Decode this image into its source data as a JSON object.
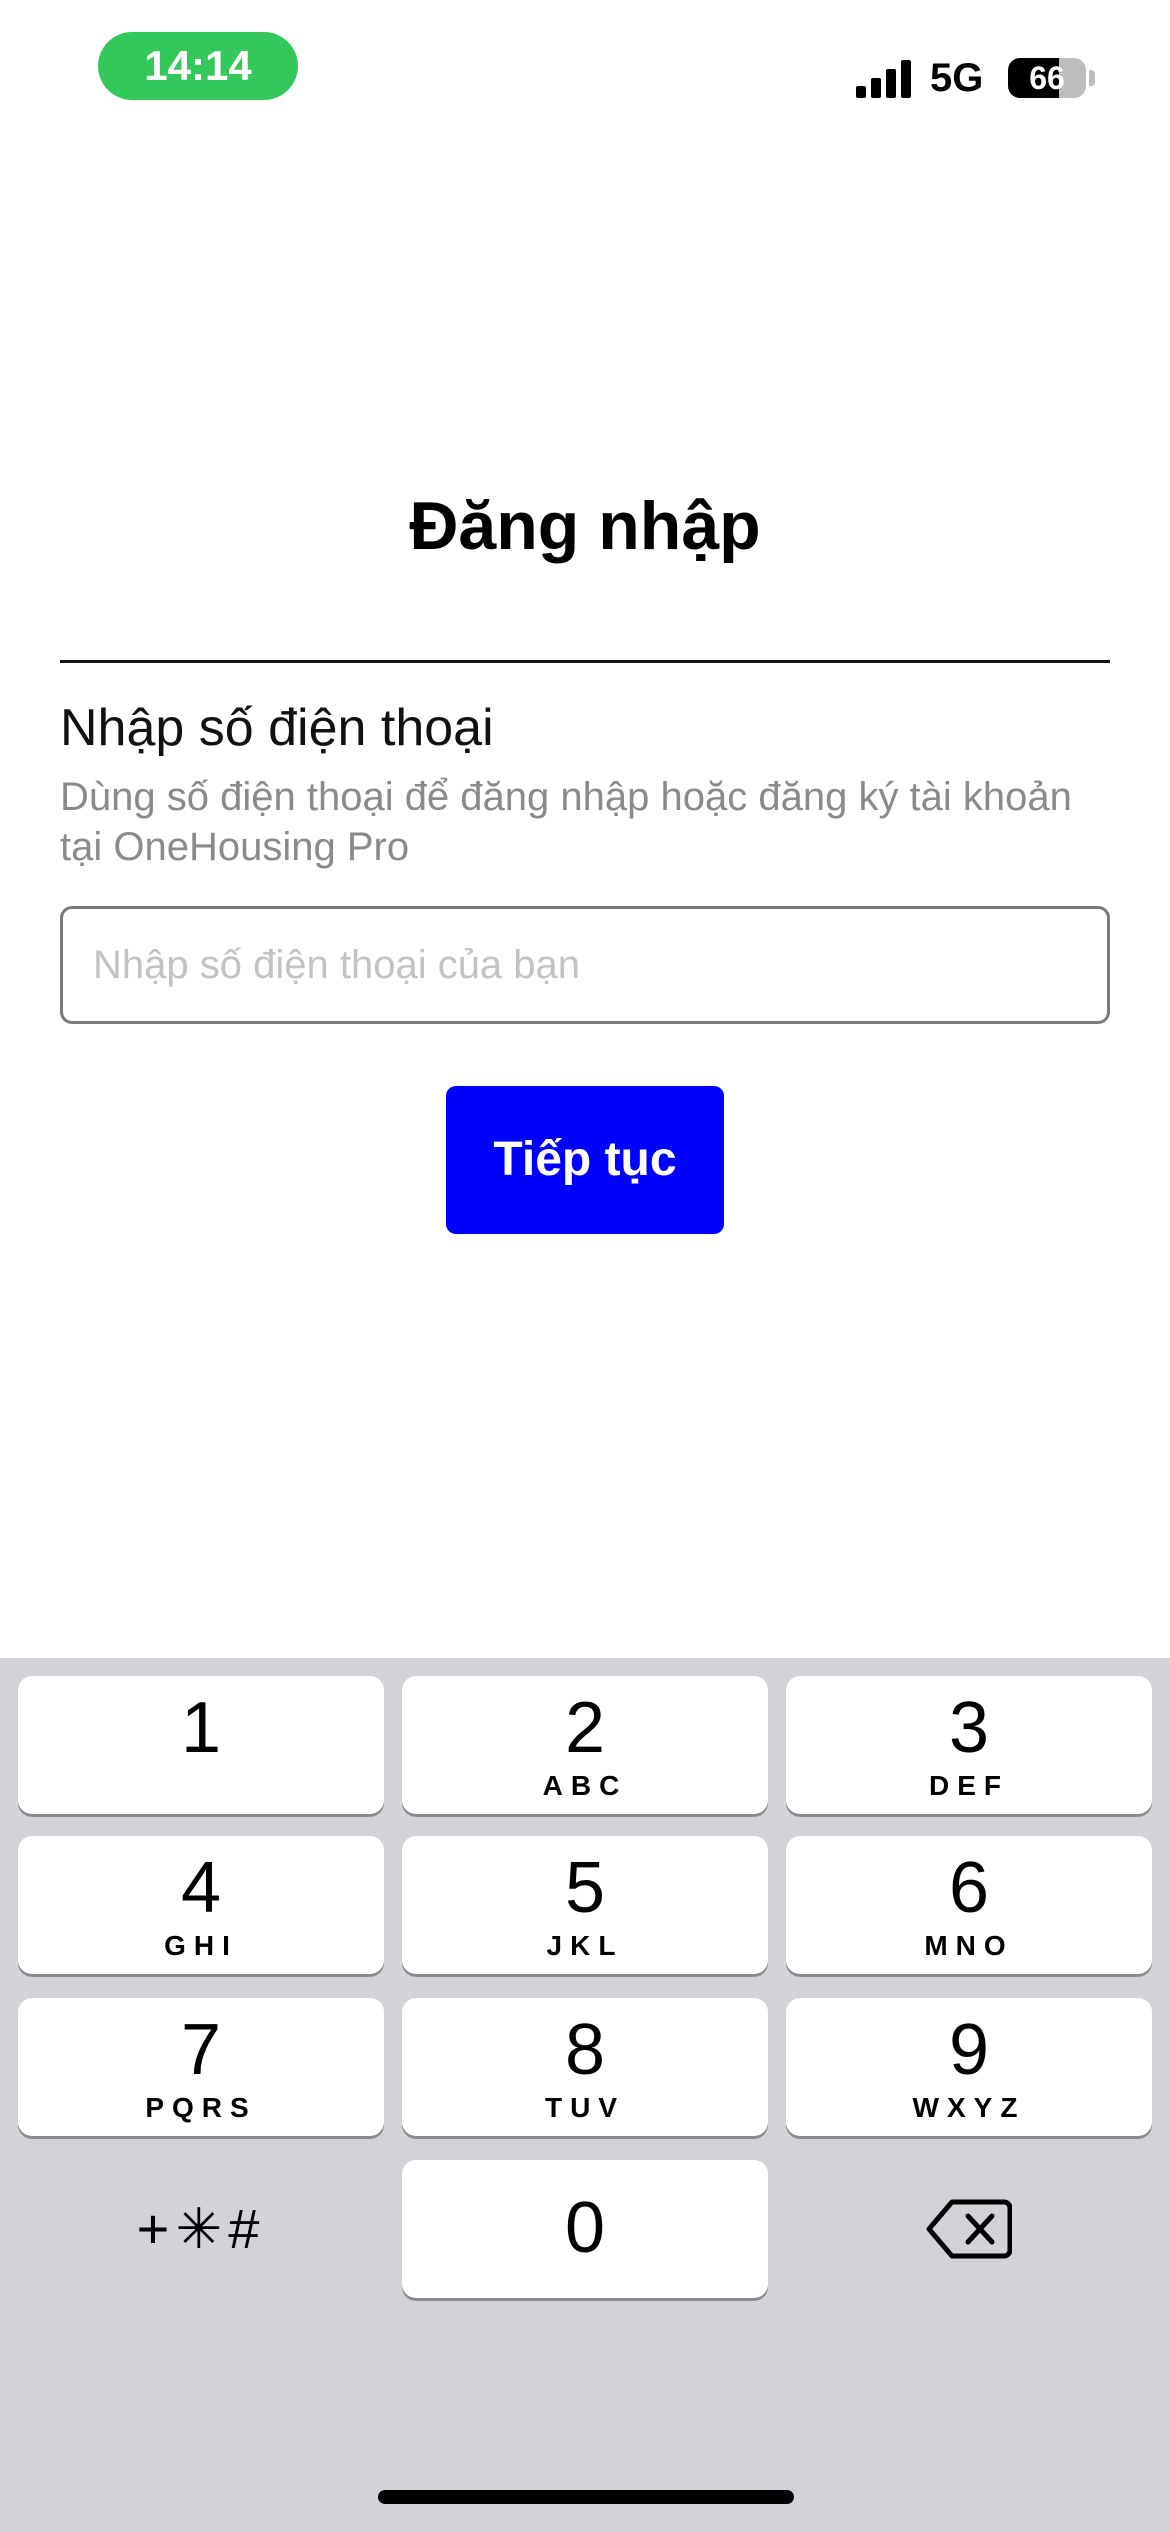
{
  "status_bar": {
    "time": "14:14",
    "network": "5G",
    "battery_level": "66",
    "battery_fraction": 0.66,
    "time_pill_color": "#34c759"
  },
  "login": {
    "title": "Đăng nhập",
    "section_heading": "Nhập số điện thoại",
    "section_description": "Dùng số điện thoại để đăng nhập hoặc đăng ký tài khoản tại OneHousing Pro",
    "phone_placeholder": "Nhập số điện thoại của bạn",
    "phone_value": "",
    "continue_label": "Tiếp tục",
    "accent_color": "#0000ff"
  },
  "keypad": {
    "keys": [
      {
        "digit": "1",
        "letters": ""
      },
      {
        "digit": "2",
        "letters": "ABC"
      },
      {
        "digit": "3",
        "letters": "DEF"
      },
      {
        "digit": "4",
        "letters": "GHI"
      },
      {
        "digit": "5",
        "letters": "JKL"
      },
      {
        "digit": "6",
        "letters": "MNO"
      },
      {
        "digit": "7",
        "letters": "PQRS"
      },
      {
        "digit": "8",
        "letters": "TUV"
      },
      {
        "digit": "9",
        "letters": "WXYZ"
      },
      {
        "digit": "0",
        "letters": ""
      }
    ],
    "symbols_label": "+✳#",
    "delete_icon": "backspace-icon"
  }
}
